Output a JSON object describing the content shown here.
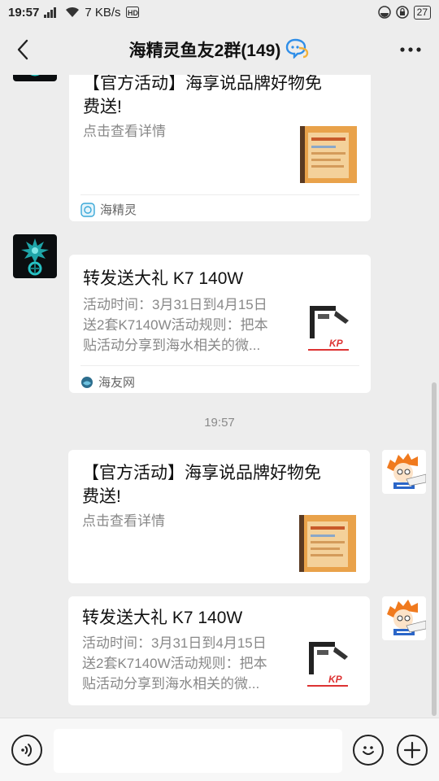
{
  "status_bar": {
    "time": "19:57",
    "network_speed": "7 KB/s",
    "battery": "27"
  },
  "header": {
    "title": "海精灵鱼友2群(149)"
  },
  "messages": [
    {
      "title": "【官方活动】海享说品牌好物免费送!",
      "title_line1": "【官方活动】海享说品牌好物免",
      "title_line2": "费送!",
      "description": "点击查看详情",
      "source": "海精灵"
    },
    {
      "title": "转发送大礼 K7 140W",
      "description_line1": "活动时间：3月31日到4月15日",
      "description_line2": "送2套K7140W活动规则：把本",
      "description_line3": "贴活动分享到海水相关的微...",
      "source": "海友网"
    },
    {
      "timestamp": "19:57"
    },
    {
      "title_line1": "【官方活动】海享说品牌好物免",
      "title_line2": "费送!",
      "description": "点击查看详情"
    },
    {
      "title": "转发送大礼 K7 140W",
      "description_line1": "活动时间：3月31日到4月15日",
      "description_line2": "送2套K7140W活动规则：把本",
      "description_line3": "贴活动分享到海水相关的微..."
    }
  ],
  "input": {
    "placeholder": ""
  }
}
